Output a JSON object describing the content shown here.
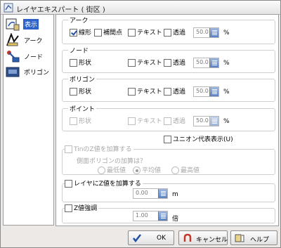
{
  "window": {
    "title": "レイヤエキスパート ( 街区 )"
  },
  "sidebar": {
    "items": [
      {
        "label": "表示",
        "icon": "display-icon",
        "selected": true
      },
      {
        "label": "アーク",
        "icon": "arc-icon"
      },
      {
        "label": "ノード",
        "icon": "node-icon"
      },
      {
        "label": "ポリゴン",
        "icon": "polygon-icon"
      }
    ]
  },
  "arc": {
    "title": "アーク",
    "shape": "線形",
    "shape_checked": true,
    "vertex": "補間点",
    "text": "テキスト",
    "transparent": "透過",
    "value": "50.0",
    "unit": "%"
  },
  "node": {
    "title": "ノード",
    "shape": "形状",
    "text": "テキスト",
    "transparent": "透過",
    "value": "50.0",
    "unit": "%"
  },
  "polygon": {
    "title": "ポリゴン",
    "shape": "形状",
    "text": "テキスト",
    "transparent": "透過",
    "value": "50.0",
    "unit": "%"
  },
  "point": {
    "title": "ポイント",
    "shape": "形状",
    "text": "テキスト",
    "transparent": "透過",
    "value": "50.0",
    "unit": "%"
  },
  "union": {
    "label": "ユニオン代表表示(U)"
  },
  "tin": {
    "label": "TinのZ値を加算する",
    "question": "側面ポリゴンの加算は？",
    "options": [
      "最低値",
      "平均値",
      "最高値"
    ],
    "selected": "平均値"
  },
  "layer_z": {
    "label": "レイヤにZ値を加算する",
    "value": "0.00",
    "unit": "m"
  },
  "z_emphasis": {
    "label": "Z値強調",
    "value": "1.00",
    "unit": "倍"
  },
  "buttons": {
    "ok": "OK",
    "cancel": "キャンセル",
    "help": "ヘルプ"
  },
  "colors": {
    "selection": "#2d63c9",
    "title_bg": "#f0f0f0",
    "panel_bg": "#ece9e6"
  }
}
